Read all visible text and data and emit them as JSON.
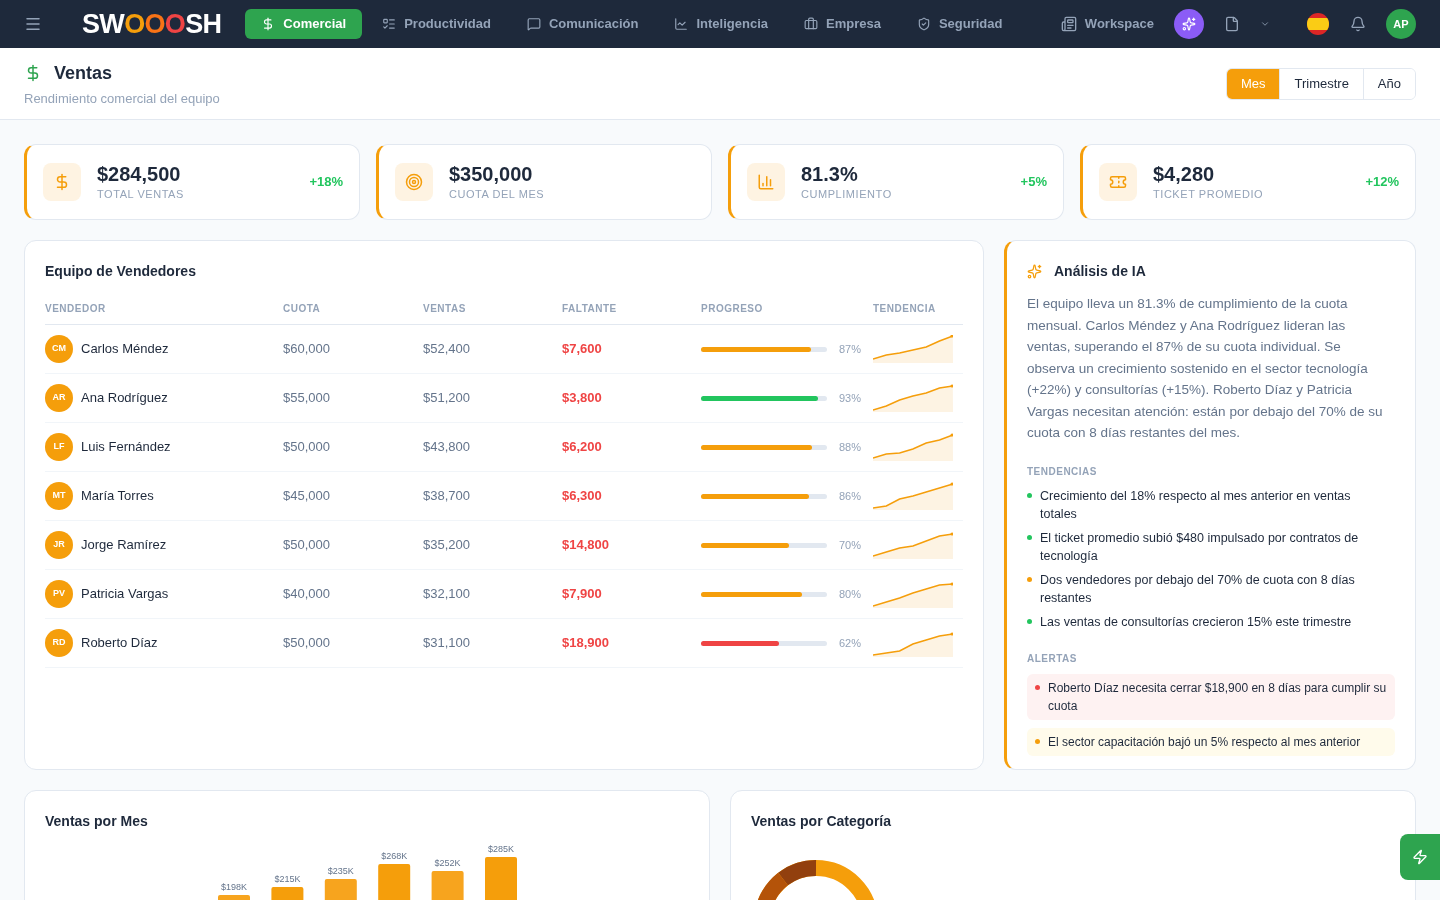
{
  "nav": {
    "logo": "SWOOOSH",
    "items": [
      {
        "label": "Comercial",
        "selected": true
      },
      {
        "label": "Productividad",
        "selected": false
      },
      {
        "label": "Comunicación",
        "selected": false
      },
      {
        "label": "Inteligencia",
        "selected": false
      },
      {
        "label": "Empresa",
        "selected": false
      },
      {
        "label": "Seguridad",
        "selected": false
      }
    ],
    "workspace": "Workspace",
    "avatar": "AP"
  },
  "header": {
    "title": "Ventas",
    "subtitle": "Rendimiento comercial del equipo",
    "periods": [
      {
        "label": "Mes",
        "selected": true
      },
      {
        "label": "Trimestre",
        "selected": false
      },
      {
        "label": "Año",
        "selected": false
      }
    ]
  },
  "kpis": [
    {
      "value": "$284,500",
      "label": "TOTAL VENTAS",
      "change": "+18%"
    },
    {
      "value": "$350,000",
      "label": "CUOTA DEL MES"
    },
    {
      "value": "81.3%",
      "label": "CUMPLIMIENTO",
      "change": "+5%"
    },
    {
      "value": "$4,280",
      "label": "TICKET PROMEDIO",
      "change": "+12%"
    }
  ],
  "team": {
    "title": "Equipo de Vendedores",
    "columns": [
      "VENDEDOR",
      "CUOTA",
      "VENTAS",
      "FALTANTE",
      "PROGRESO",
      "TENDENCIA"
    ],
    "rows": [
      {
        "initials": "CM",
        "name": "Carlos Méndez",
        "quota": "$60,000",
        "sales": "$52,400",
        "missing": "$7,600",
        "level": 0.87,
        "color": "#f59e0b",
        "percent": "87%"
      },
      {
        "initials": "AR",
        "name": "Ana Rodríguez",
        "quota": "$55,000",
        "sales": "$51,200",
        "missing": "$3,800",
        "level": 0.93,
        "color": "#22c55e",
        "percent": "93%"
      },
      {
        "initials": "LF",
        "name": "Luis Fernández",
        "quota": "$50,000",
        "sales": "$43,800",
        "missing": "$6,200",
        "level": 0.88,
        "color": "#f59e0b",
        "percent": "88%"
      },
      {
        "initials": "MT",
        "name": "María Torres",
        "quota": "$45,000",
        "sales": "$38,700",
        "missing": "$6,300",
        "level": 0.86,
        "color": "#f59e0b",
        "percent": "86%"
      },
      {
        "initials": "JR",
        "name": "Jorge Ramírez",
        "quota": "$50,000",
        "sales": "$35,200",
        "missing": "$14,800",
        "level": 0.7,
        "color": "#f59e0b",
        "percent": "70%"
      },
      {
        "initials": "PV",
        "name": "Patricia Vargas",
        "quota": "$40,000",
        "sales": "$32,100",
        "missing": "$7,900",
        "level": 0.8,
        "color": "#f59e0b",
        "percent": "80%"
      },
      {
        "initials": "RD",
        "name": "Roberto Díaz",
        "quota": "$50,000",
        "sales": "$31,100",
        "missing": "$18,900",
        "level": 0.62,
        "color": "#ef4444",
        "percent": "62%"
      }
    ]
  },
  "ai": {
    "title": "Análisis de IA",
    "summary": "El equipo lleva un 81.3% de cumplimiento de la cuota mensual. Carlos Méndez y Ana Rodríguez lideran las ventas, superando el 87% de su cuota individual. Se observa un crecimiento sostenido en el sector tecnología (+22%) y consultorías (+15%). Roberto Díaz y Patricia Vargas necesitan atención: están por debajo del 70% de su cuota con 8 días restantes del mes.",
    "trends_title": "TENDENCIAS",
    "trends": [
      {
        "text": "Crecimiento del 18% respecto al mes anterior en ventas totales",
        "color": "#22c55e"
      },
      {
        "text": "El ticket promedio subió $480 impulsado por contratos de tecnología",
        "color": "#22c55e"
      },
      {
        "text": "Dos vendedores por debajo del 70% de cuota con 8 días restantes",
        "color": "#f59e0b"
      },
      {
        "text": "Las ventas de consultorías crecieron 15% este trimestre",
        "color": "#22c55e"
      }
    ],
    "alerts_title": "ALERTAS",
    "alerts": [
      {
        "text": "Roberto Díaz necesita cerrar $18,900 en 8 días para cumplir su cuota",
        "kind": "danger"
      },
      {
        "text": "El sector capacitación bajó un 5% respecto al mes anterior",
        "kind": "warning"
      }
    ]
  },
  "monthly": {
    "title": "Ventas por Mes",
    "bar_labels": [
      "$198K",
      "$215K",
      "$235K",
      "$268K",
      "$252K",
      "$285K"
    ]
  },
  "category": {
    "title": "Ventas por Categoría"
  }
}
